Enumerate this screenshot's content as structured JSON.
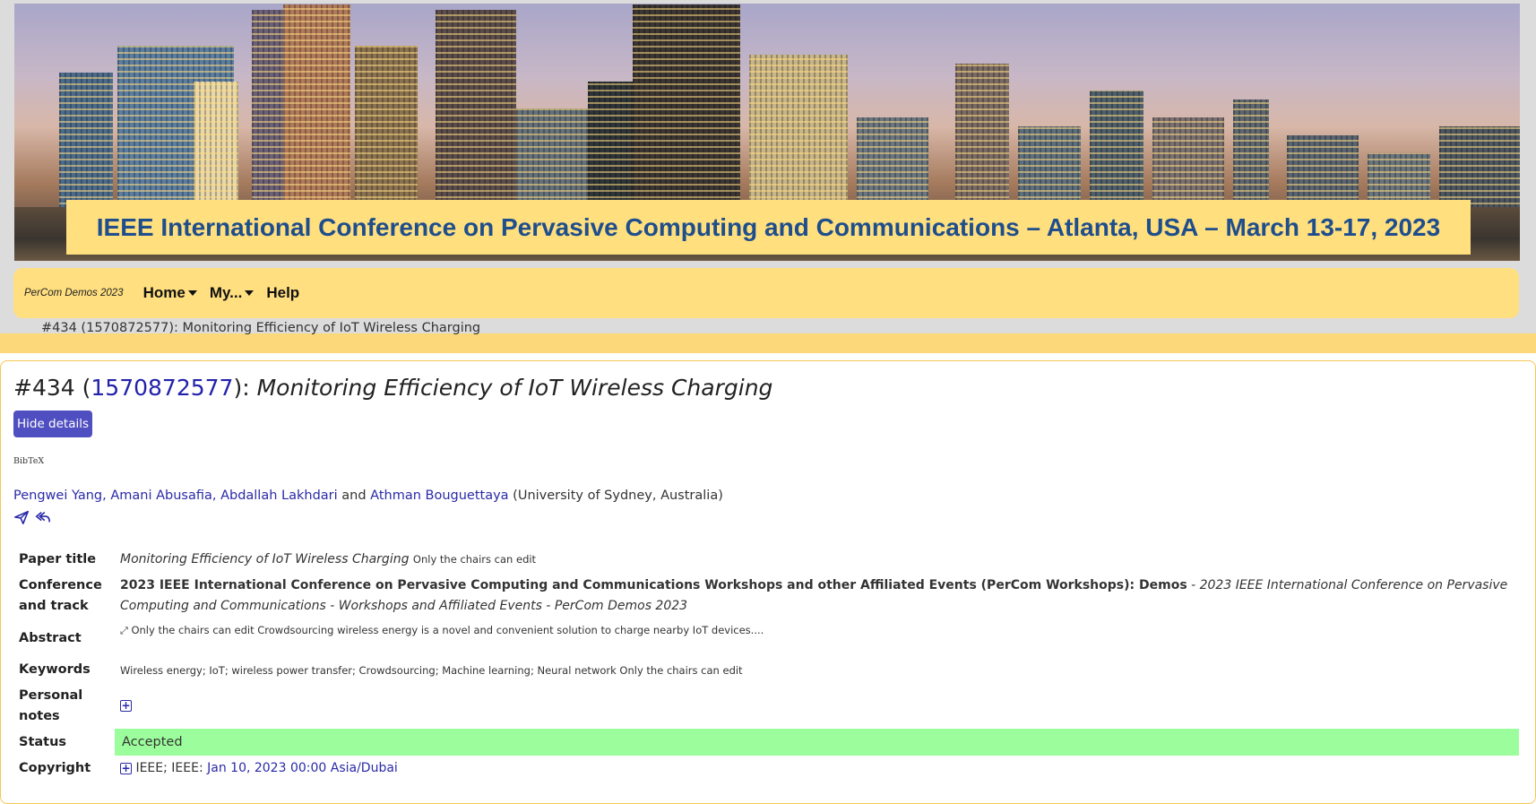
{
  "banner": {
    "title": "IEEE International Conference on Pervasive Computing and Communications – Atlanta, USA – March 13-17, 2023"
  },
  "nav": {
    "brand": "PerCom Demos 2023",
    "items": [
      {
        "label": "Home",
        "dropdown": true
      },
      {
        "label": "My...",
        "dropdown": true
      },
      {
        "label": "Help",
        "dropdown": false
      }
    ]
  },
  "breadcrumb": "#434 (1570872577): Monitoring Efficiency of IoT Wireless Charging",
  "paper": {
    "number": "#434",
    "id": "1570872577",
    "title": "Monitoring Efficiency of IoT Wireless Charging",
    "hide_details_label": "Hide details",
    "bibtex_label": "BibTeX",
    "authors_linked": "Pengwei Yang, Amani Abusafia, Abdallah Lakhdari",
    "authors_and": "and",
    "author_last": "Athman Bouguettaya",
    "affiliation": "(University of Sydney, Australia)"
  },
  "details": {
    "paper_title_label": "Paper title",
    "paper_title_value": "Monitoring Efficiency of IoT Wireless Charging",
    "chairs_only": "Only the chairs can edit",
    "conf_label": "Conference and track",
    "conf_bold": "2023 IEEE International Conference on Pervasive Computing and Communications Workshops and other Affiliated Events (PerCom Workshops): Demos",
    "conf_italic": "- 2023 IEEE International Conference on Pervasive Computing and Communications - Workshops and Affiliated Events - PerCom Demos 2023",
    "abstract_label": "Abstract",
    "abstract_value": "Only the chairs can edit Crowdsourcing wireless energy is a novel and convenient solution to charge nearby IoT devices....",
    "keywords_label": "Keywords",
    "keywords_value": "Wireless energy; IoT; wireless power transfer; Crowdsourcing; Machine learning; Neural network Only the chairs can edit",
    "notes_label": "Personal notes",
    "status_label": "Status",
    "status_value": "Accepted",
    "copyright_label": "Copyright",
    "copyright_text": "IEEE; IEEE:",
    "copyright_date": "Jan 10, 2023 00:00 Asia/Dubai"
  },
  "colors": {
    "accent": "#4f4fc1",
    "link": "#2a2aa8",
    "nav_bg": "#ffdf80",
    "status_accepted": "#9cfd9c",
    "banner_title": "#1f4e8c"
  }
}
